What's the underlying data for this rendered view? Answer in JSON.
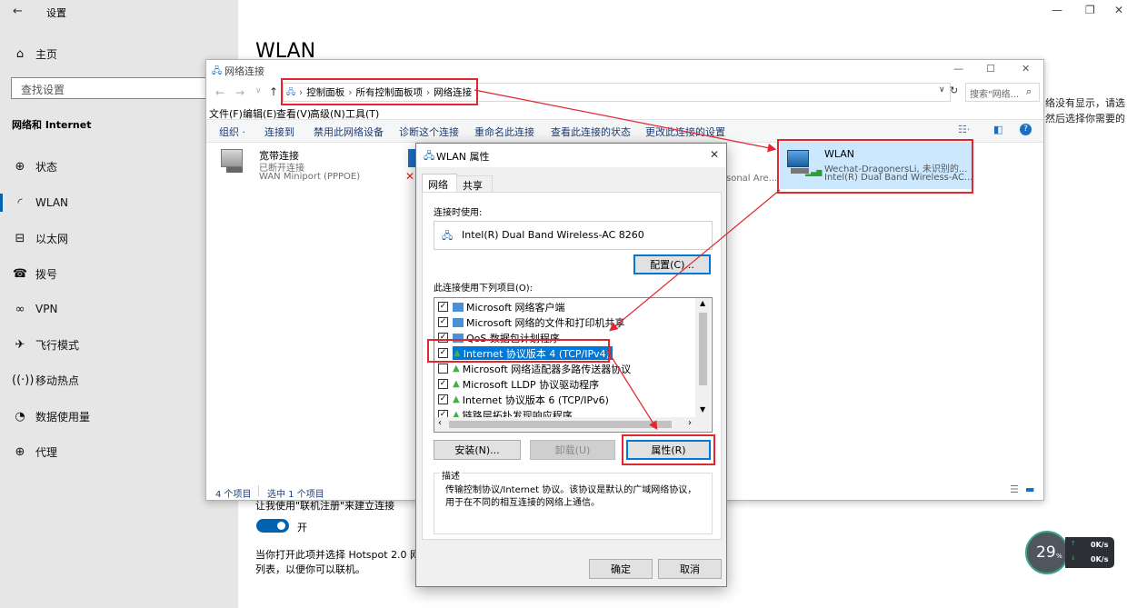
{
  "settings": {
    "back_arrow": "←",
    "title": "设置",
    "home": "主页",
    "search_placeholder": "查找设置",
    "section": "网络和 Internet",
    "nav": [
      "状态",
      "WLAN",
      "以太网",
      "拨号",
      "VPN",
      "飞行模式",
      "移动热点",
      "数据使用量",
      "代理"
    ],
    "page_title": "WLAN",
    "right_text_1": "络没有显示，请选",
    "right_text_2": "然后选择你需要的",
    "register_text": "让我使用\"联机注册\"来建立连接",
    "toggle_label": "开",
    "hotspot_text_1": "当你打开此项并选择 Hotspot 2.0 网",
    "hotspot_text_2": "列表，以便你可以联机。"
  },
  "explorer": {
    "title": "网络连接",
    "breadcrumb": [
      "控制面板",
      "所有控制面板项",
      "网络连接"
    ],
    "search_placeholder": "搜索\"网络...",
    "menu": [
      "文件(F)",
      "编辑(E)",
      "查看(V)",
      "高级(N)",
      "工具(T)"
    ],
    "commands": [
      "组织 ·",
      "连接到",
      "禁用此网络设备",
      "诊断这个连接",
      "重命名此连接",
      "查看此连接的状态",
      "更改此连接的设置"
    ],
    "broadband": {
      "name": "宽带连接",
      "status": "已断开连接",
      "device": "WAN Miniport (PPPOE)"
    },
    "partial_text": "sonal Are...",
    "wlan": {
      "name": "WLAN",
      "network": "Wechat-DragonersLi, 未识别的...",
      "device": "Intel(R) Dual Band Wireless-AC..."
    },
    "status_count": "4 个项目",
    "status_selected": "选中 1 个项目"
  },
  "dialog": {
    "title": "WLAN 属性",
    "tabs": [
      "网络",
      "共享"
    ],
    "connect_using_label": "连接时使用:",
    "adapter": "Intel(R) Dual Band Wireless-AC 8260",
    "configure_button": "配置(C)...",
    "items_label": "此连接使用下列项目(O):",
    "items": [
      {
        "label": "Microsoft 网络客户端",
        "checked": true
      },
      {
        "label": "Microsoft 网络的文件和打印机共享",
        "checked": true
      },
      {
        "label": "QoS 数据包计划程序",
        "checked": true
      },
      {
        "label": "Internet 协议版本 4 (TCP/IPv4)",
        "checked": true,
        "selected": true
      },
      {
        "label": "Microsoft 网络适配器多路传送器协议",
        "checked": false
      },
      {
        "label": "Microsoft LLDP 协议驱动程序",
        "checked": true
      },
      {
        "label": "Internet 协议版本 6 (TCP/IPv6)",
        "checked": true
      },
      {
        "label": "链路层拓扑发现响应程序",
        "checked": true
      }
    ],
    "install_button": "安装(N)...",
    "uninstall_button": "卸载(U)",
    "properties_button": "属性(R)",
    "description_label": "描述",
    "description": "传输控制协议/Internet 协议。该协议是默认的广域网络协议，用于在不同的相互连接的网络上通信。",
    "ok_button": "确定",
    "cancel_button": "取消"
  },
  "speed_widget": {
    "percent": "29",
    "percent_unit": "%",
    "up": "0K/s",
    "down": "0K/s"
  },
  "colors": {
    "accent": "#0063b1",
    "highlight": "#0078d7",
    "annotation": "#e0262f"
  }
}
